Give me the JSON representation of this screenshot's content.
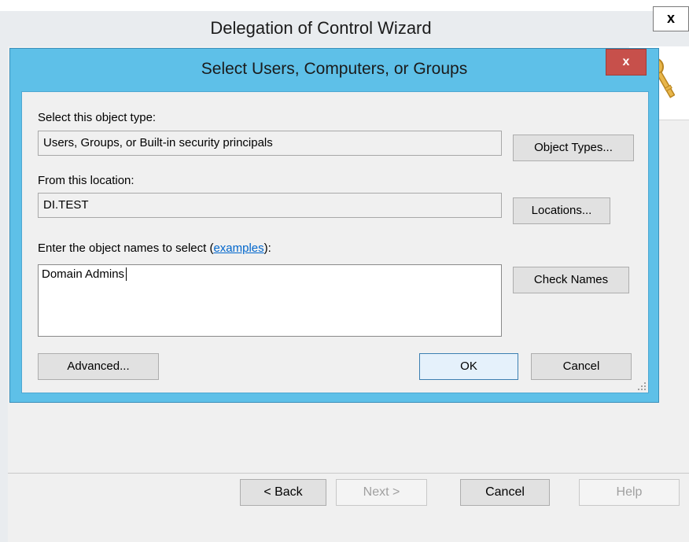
{
  "wizard": {
    "title": "Delegation of Control Wizard",
    "close_glyph": "x",
    "buttons": {
      "back": "< Back",
      "next": "Next >",
      "cancel": "Cancel",
      "help": "Help"
    },
    "icon": "key-icon"
  },
  "dialog": {
    "title": "Select Users, Computers, or Groups",
    "close_glyph": "x",
    "object_type": {
      "label": "Select this object type:",
      "value": "Users, Groups, or Built-in security principals",
      "button": "Object Types..."
    },
    "location": {
      "label": "From this location:",
      "value": "DI.TEST",
      "button": "Locations..."
    },
    "names": {
      "label_prefix": "Enter the object names to select (",
      "label_link": "examples",
      "label_suffix": "):",
      "value": "Domain Admins",
      "button": "Check Names"
    },
    "buttons": {
      "advanced": "Advanced...",
      "ok": "OK",
      "cancel": "Cancel"
    }
  },
  "colors": {
    "dialog_frame": "#5ec0e8",
    "close_red": "#c7504b",
    "link_blue": "#0066cc"
  }
}
